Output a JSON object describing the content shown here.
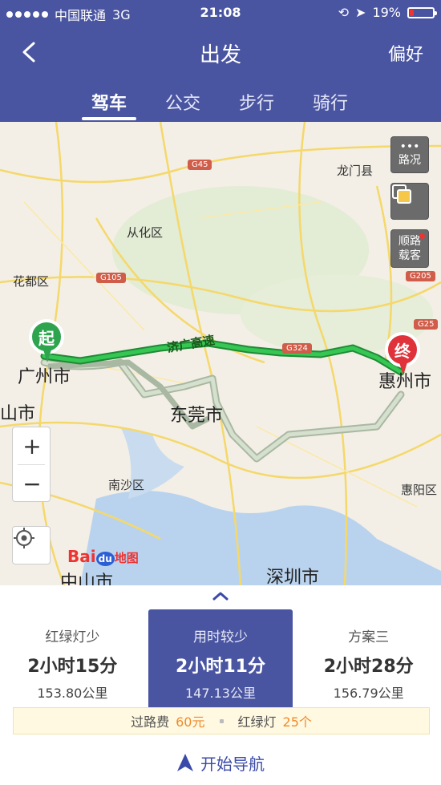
{
  "status": {
    "carrier": "中国联通",
    "network": "3G",
    "time": "21:08",
    "battery": "19%",
    "battery_level": 0.19
  },
  "nav": {
    "title": "出发",
    "preference": "偏好"
  },
  "tabs": [
    {
      "label": "驾车",
      "active": true
    },
    {
      "label": "公交",
      "active": false
    },
    {
      "label": "步行",
      "active": false
    },
    {
      "label": "骑行",
      "active": false
    }
  ],
  "map": {
    "controls": {
      "traffic": "路况",
      "hitch_1": "顺路",
      "hitch_2": "载客",
      "zoom_in": "+",
      "zoom_out": "−"
    },
    "logo": {
      "brand": "Bai",
      "mid": "du",
      "suffix": "地图"
    },
    "labels": {
      "longmen": "龙门县",
      "conghua": "从化区",
      "huadu": "花都区",
      "guangzhou": "广州市",
      "shan": "山市",
      "dongguan": "东莞市",
      "nansha": "南沙区",
      "zhongshan": "中山市",
      "shenzhen": "深圳市",
      "huizhou": "惠州市",
      "huiyang": "惠阳区",
      "expressway": "济广高速"
    },
    "shields": {
      "g45": "G45",
      "g105": "G105",
      "g205": "G205",
      "g25": "G25",
      "g324": "G324"
    },
    "start_marker": "起",
    "end_marker": "终"
  },
  "plans": [
    {
      "label": "红绿灯少",
      "duration": "2小时15分",
      "distance": "153.80公里",
      "selected": false
    },
    {
      "label": "用时较少",
      "duration": "2小时11分",
      "distance": "147.13公里",
      "selected": true
    },
    {
      "label": "方案三",
      "duration": "2小时28分",
      "distance": "156.79公里",
      "selected": false
    }
  ],
  "tolls": {
    "toll_label": "过路费",
    "toll_value": "60元",
    "lights_label": "红绿灯",
    "lights_value": "25个"
  },
  "start_nav": "开始导航",
  "colors": {
    "brand": "#4a55a2",
    "route_active": "#2db84b",
    "route_alt": "#b8c8ae",
    "start_pin": "#2ea44f",
    "end_pin": "#e0323a"
  }
}
